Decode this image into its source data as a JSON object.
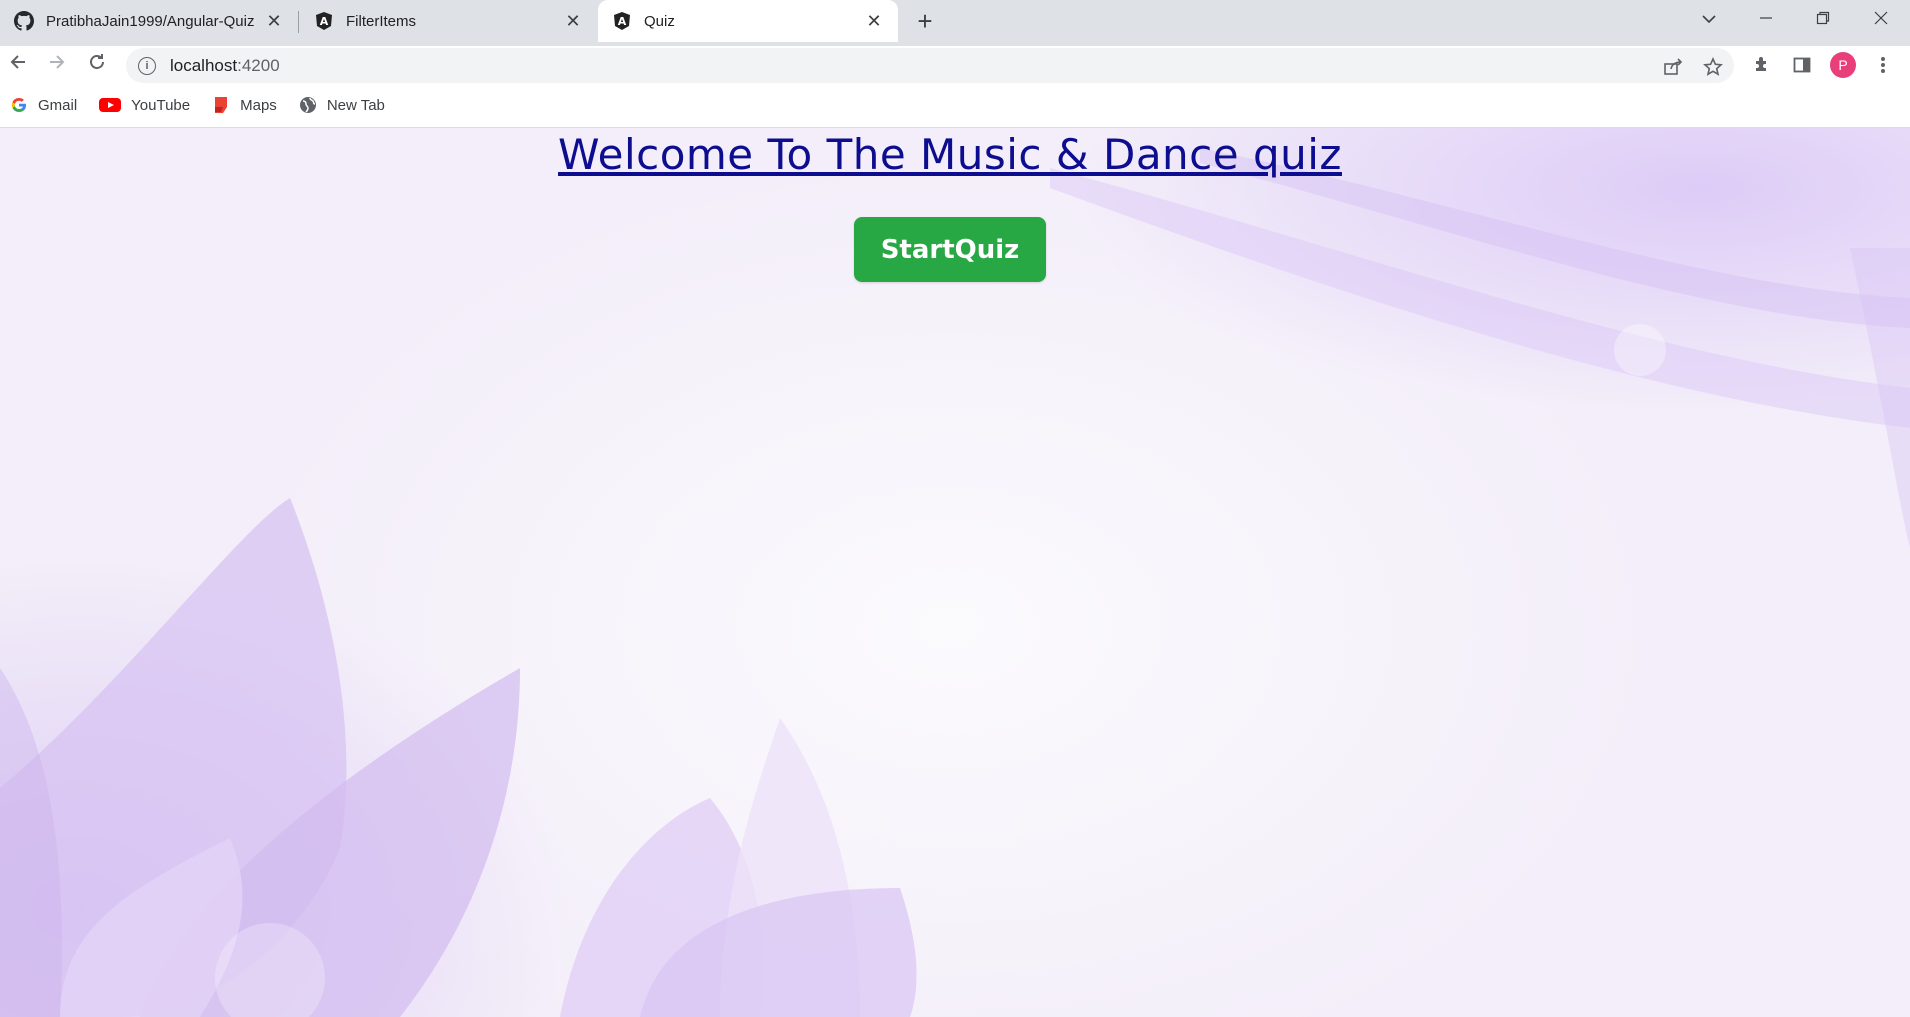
{
  "browser": {
    "tabs": [
      {
        "title": "PratibhaJain1999/Angular-Quiz",
        "icon": "github-icon"
      },
      {
        "title": "FilterItems",
        "icon": "angular-icon"
      },
      {
        "title": "Quiz",
        "icon": "angular-icon",
        "active": true
      }
    ],
    "address": {
      "host": "localhost",
      "port": ":4200"
    },
    "profile_initial": "P",
    "bookmarks": [
      {
        "label": "Gmail",
        "icon": "google-icon"
      },
      {
        "label": "YouTube",
        "icon": "youtube-icon"
      },
      {
        "label": "Maps",
        "icon": "maps-icon"
      },
      {
        "label": "New Tab",
        "icon": "globe-icon"
      }
    ]
  },
  "page": {
    "title": "Welcome To The Music & Dance quiz",
    "start_button": "StartQuiz"
  },
  "colors": {
    "title": "#0d0d8f",
    "button": "#28a745",
    "avatar": "#e83f7a"
  }
}
